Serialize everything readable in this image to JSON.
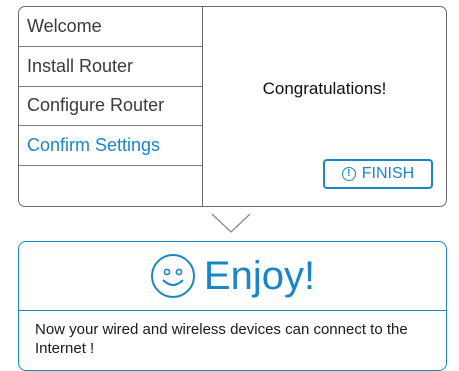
{
  "wizard": {
    "steps": [
      {
        "label": "Welcome",
        "active": false
      },
      {
        "label": "Install Router",
        "active": false
      },
      {
        "label": "Configure Router",
        "active": false
      },
      {
        "label": "Confirm Settings",
        "active": true
      },
      {
        "label": "",
        "active": false
      }
    ],
    "congrats_text": "Congratulations!",
    "finish_label": "FINISH",
    "finish_icon": "info-circle-icon"
  },
  "enjoy": {
    "title": "Enjoy!",
    "icon": "smiley-icon",
    "message": "Now your wired and wireless devices can connect to the Internet !"
  },
  "colors": {
    "accent": "#1a86c8",
    "border": "#6b6b6b",
    "text": "#3a3a3a"
  }
}
